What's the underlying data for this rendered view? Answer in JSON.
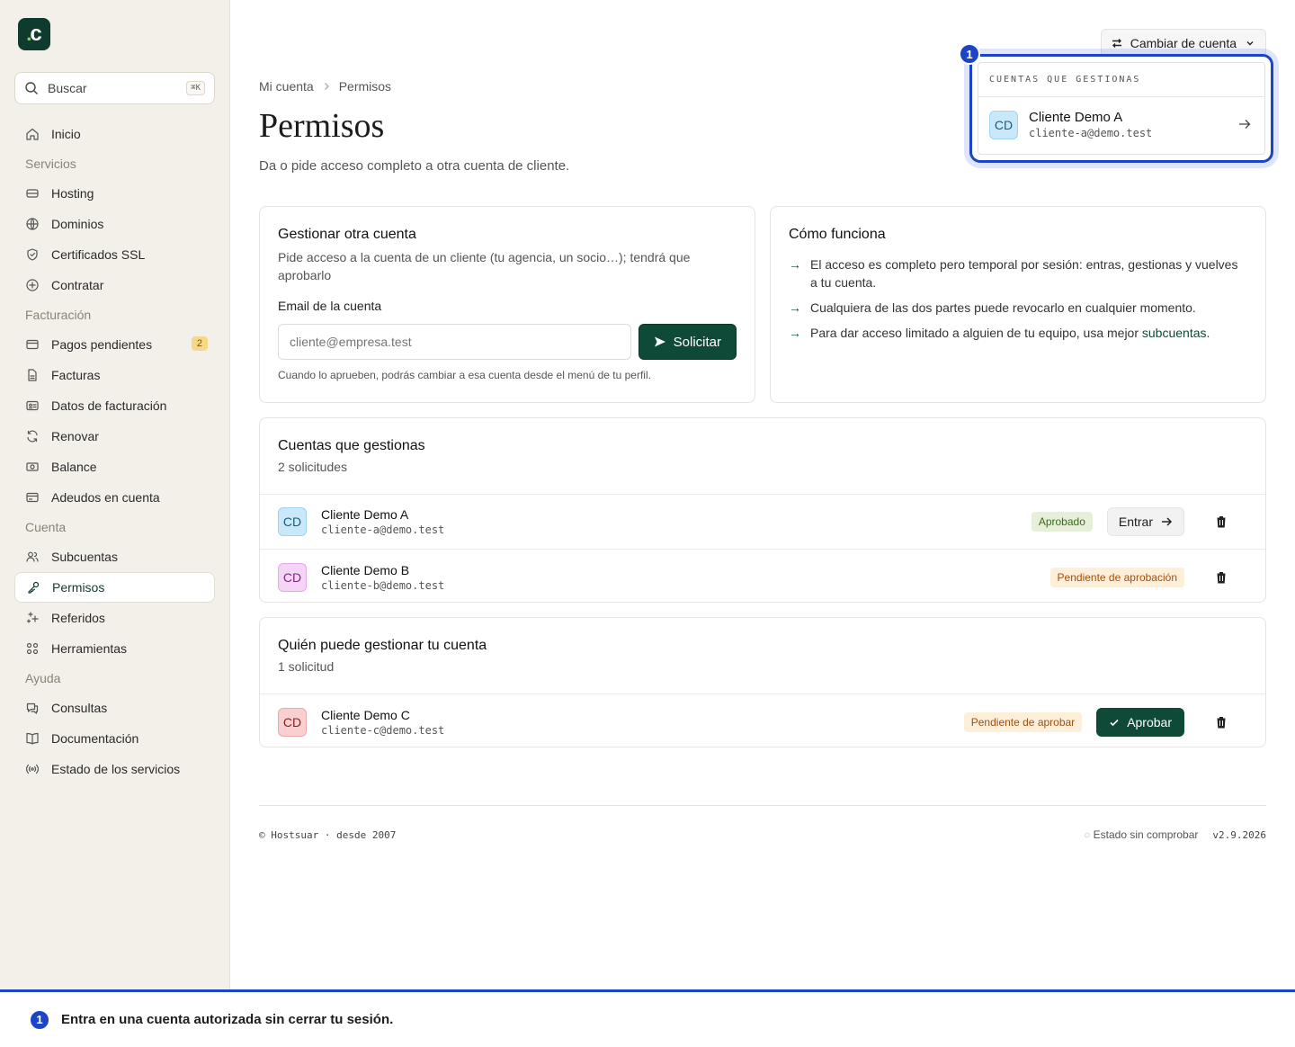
{
  "app": {
    "logo_text": "c"
  },
  "sidebar": {
    "search_label": "Buscar",
    "search_shortcut": "⌘K",
    "items": [
      {
        "type": "item",
        "label": "Inicio",
        "icon": "home-icon"
      },
      {
        "type": "section",
        "label": "Servicios"
      },
      {
        "type": "item",
        "label": "Hosting",
        "icon": "server-icon"
      },
      {
        "type": "item",
        "label": "Dominios",
        "icon": "globe-icon"
      },
      {
        "type": "item",
        "label": "Certificados SSL",
        "icon": "shield-icon"
      },
      {
        "type": "item",
        "label": "Contratar",
        "icon": "plus-circle-icon"
      },
      {
        "type": "section",
        "label": "Facturación"
      },
      {
        "type": "item",
        "label": "Pagos pendientes",
        "icon": "wallet-icon",
        "badge": "2"
      },
      {
        "type": "item",
        "label": "Facturas",
        "icon": "file-icon"
      },
      {
        "type": "item",
        "label": "Datos de facturación",
        "icon": "id-card-icon"
      },
      {
        "type": "item",
        "label": "Renovar",
        "icon": "refresh-icon"
      },
      {
        "type": "item",
        "label": "Balance",
        "icon": "banknote-icon"
      },
      {
        "type": "item",
        "label": "Adeudos en cuenta",
        "icon": "credit-card-icon"
      },
      {
        "type": "section",
        "label": "Cuenta"
      },
      {
        "type": "item",
        "label": "Subcuentas",
        "icon": "users-icon"
      },
      {
        "type": "item",
        "label": "Permisos",
        "icon": "key-icon",
        "active": true
      },
      {
        "type": "item",
        "label": "Referidos",
        "icon": "sparkles-icon"
      },
      {
        "type": "item",
        "label": "Herramientas",
        "icon": "grid-icon"
      },
      {
        "type": "section",
        "label": "Ayuda"
      },
      {
        "type": "item",
        "label": "Consultas",
        "icon": "chat-icon"
      },
      {
        "type": "item",
        "label": "Documentación",
        "icon": "book-icon"
      },
      {
        "type": "item",
        "label": "Estado de los servicios",
        "icon": "radio-icon"
      }
    ]
  },
  "header": {
    "switch_label": "Cambiar de cuenta",
    "breadcrumb": [
      "Mi cuenta",
      "Permisos"
    ],
    "title": "Permisos",
    "subtitle": "Da o pide acceso completo a otra cuenta de cliente."
  },
  "request_card": {
    "title": "Gestionar otra cuenta",
    "desc": "Pide acceso a la cuenta de un cliente (tu agencia, un socio…); tendrá que aprobarlo",
    "field_label": "Email de la cuenta",
    "placeholder": "cliente@empresa.test",
    "button": "Solicitar",
    "hint": "Cuando lo aprueben, podrás cambiar a esa cuenta desde el menú de tu perfil."
  },
  "how_card": {
    "title": "Cómo funciona",
    "points": [
      "El acceso es completo pero temporal por sesión: entras, gestionas y vuelves a tu cuenta.",
      "Cualquiera de las dos partes puede revocarlo en cualquier momento."
    ],
    "point3_prefix": "Para dar acceso limitado a alguien de tu equipo, usa mejor ",
    "point3_link": "subcuentas",
    "point3_suffix": "."
  },
  "managed": {
    "title": "Cuentas que gestionas",
    "count": "2 solicitudes",
    "rows": [
      {
        "initials": "CD",
        "name": "Cliente Demo A",
        "email": "cliente-a@demo.test",
        "status": "Aprobado",
        "action": "Entrar"
      },
      {
        "initials": "CD",
        "name": "Cliente Demo B",
        "email": "cliente-b@demo.test",
        "status": "Pendiente de aprobación"
      }
    ]
  },
  "managers": {
    "title": "Quién puede gestionar tu cuenta",
    "count": "1 solicitud",
    "rows": [
      {
        "initials": "CD",
        "name": "Cliente Demo C",
        "email": "cliente-c@demo.test",
        "status": "Pendiente de aprobar",
        "action": "Aprobar"
      }
    ]
  },
  "footer": {
    "copyright": "© Hostsuar · desde 2007",
    "status": "Estado sin comprobar",
    "version": "v2.9.2026"
  },
  "popover": {
    "marker": "1",
    "heading": "CUENTAS QUE GESTIONAS",
    "item": {
      "initials": "CD",
      "name": "Cliente Demo A",
      "email": "cliente-a@demo.test"
    }
  },
  "tip": {
    "marker": "1",
    "text": "Entra en una cuenta autorizada sin cerrar tu sesión."
  },
  "colors": {
    "brand": "#0f4a39",
    "accent": "#1c44c4",
    "approved_bg": "#e6f0d8",
    "pending_bg": "#fdefd9"
  }
}
